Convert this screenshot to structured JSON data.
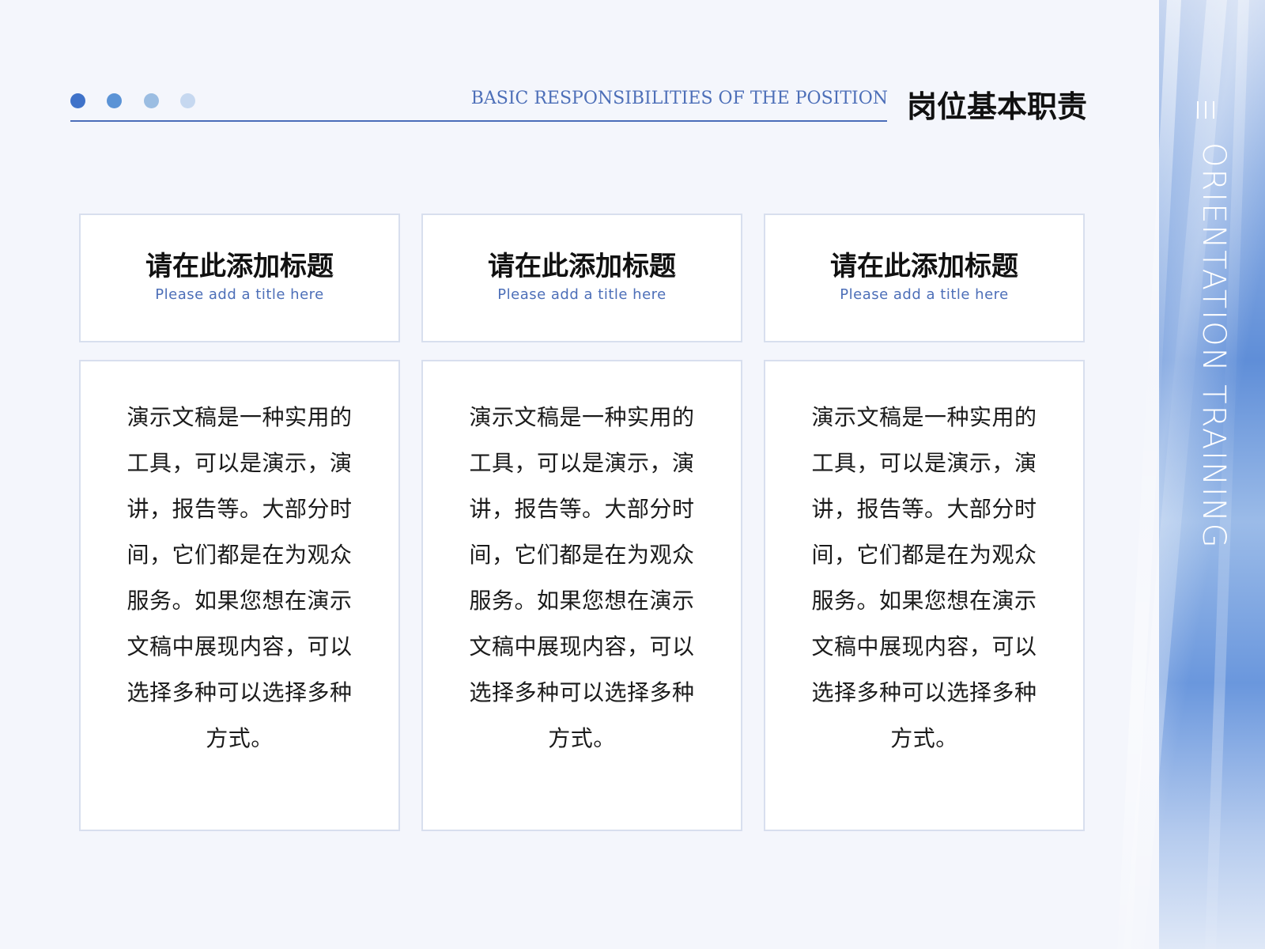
{
  "header": {
    "title_en": "BASIC RESPONSIBILITIES OF THE POSITION",
    "title_cn": "岗位基本职责",
    "dot_colors": [
      "#3f72c9",
      "#5b93d6",
      "#9bbde2",
      "#c6d8f0"
    ],
    "accent_color": "#4a6db9"
  },
  "cards": [
    {
      "title_cn": "请在此添加标题",
      "title_en": "Please add a title here",
      "body": "演示文稿是一种实用的工具，可以是演示，演讲，报告等。大部分时间，它们都是在为观众服务。如果您想在演示文稿中展现内容，可以选择多种可以选择多种方式。"
    },
    {
      "title_cn": "请在此添加标题",
      "title_en": "Please add a title here",
      "body": "演示文稿是一种实用的工具，可以是演示，演讲，报告等。大部分时间，它们都是在为观众服务。如果您想在演示文稿中展现内容，可以选择多种可以选择多种方式。"
    },
    {
      "title_cn": "请在此添加标题",
      "title_en": "Please add a title here",
      "body": "演示文稿是一种实用的工具，可以是演示，演讲，报告等。大部分时间，它们都是在为观众服务。如果您想在演示文稿中展现内容，可以选择多种可以选择多种方式。"
    }
  ],
  "side": {
    "icon": "menu-lines-icon",
    "text": "ORIENTATION TRAINING"
  }
}
